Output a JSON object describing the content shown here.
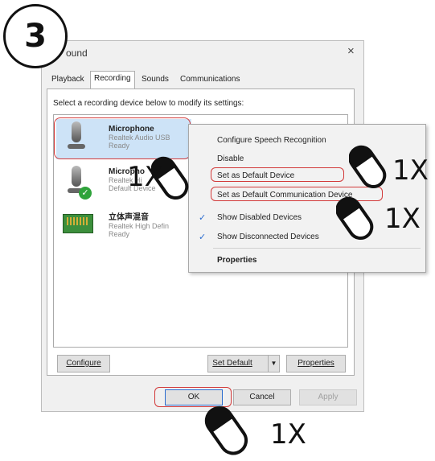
{
  "step_number": "3",
  "window": {
    "title": "ound",
    "close_glyph": "×"
  },
  "tabs": [
    "Playback",
    "Recording",
    "Sounds",
    "Communications"
  ],
  "instruction": "Select a recording device below to modify its settings:",
  "devices": [
    {
      "name": "Microphone",
      "line2": "Realtek Audio USB",
      "status": "Ready",
      "icon": "microphone-icon"
    },
    {
      "name": "Micropho",
      "line2": "Realtek Hi",
      "status": "Default Device",
      "icon": "microphone-default-icon"
    },
    {
      "name": "立体声混音",
      "line2": "Realtek High Defin",
      "status": "Ready",
      "icon": "sound-card-icon"
    }
  ],
  "context_menu": {
    "items": [
      {
        "label": "Configure Speech Recognition",
        "checked": false
      },
      {
        "label": "Disable",
        "checked": false
      },
      {
        "label": "Set as Default Device",
        "checked": false
      },
      {
        "label": "Set as Default Communication Device",
        "checked": false
      },
      {
        "label": "Show Disabled Devices",
        "checked": true
      },
      {
        "label": "Show Disconnected Devices",
        "checked": true
      },
      {
        "label": "Properties",
        "checked": false
      }
    ]
  },
  "buttons": {
    "configure": "Configure",
    "set_default": "Set Default",
    "set_default_arrow": "▼",
    "properties": "Properties",
    "ok": "OK",
    "cancel": "Cancel",
    "apply": "Apply"
  },
  "annotations": {
    "click_device": "1X",
    "click_default": "1X",
    "click_comm": "1X",
    "click_ok": "1X"
  },
  "colors": {
    "highlight": "#d23a3a",
    "selection": "#cde3f7",
    "check": "#2b6ccf",
    "default_badge": "#2fa33b"
  }
}
